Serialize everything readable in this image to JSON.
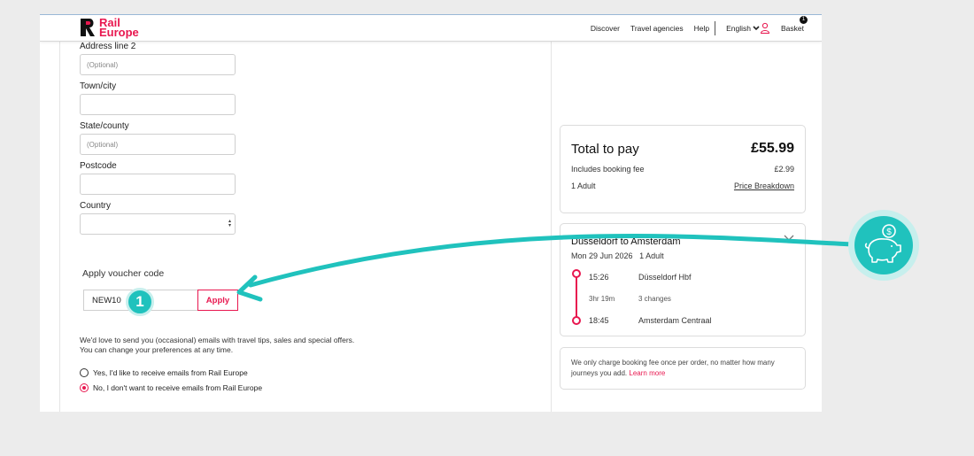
{
  "header": {
    "logo_line1": "Rail",
    "logo_line2": "Europe",
    "nav": {
      "discover": "Discover",
      "travel_agencies": "Travel agencies",
      "help": "Help",
      "language": "English",
      "basket": "Basket",
      "basket_count": "1"
    }
  },
  "form": {
    "address2_label": "Address line 2",
    "address2_placeholder": "(Optional)",
    "town_label": "Town/city",
    "state_label": "State/county",
    "state_placeholder": "(Optional)",
    "postcode_label": "Postcode",
    "country_label": "Country"
  },
  "voucher": {
    "label": "Apply voucher code",
    "value": "NEW10",
    "apply_label": "Apply",
    "step_number": "1"
  },
  "emails": {
    "line1": "We'd love to send you (occasional) emails with travel tips, sales and special offers.",
    "line2": "You can change your preferences at any time.",
    "option_yes": "Yes, I'd like to receive emails from Rail Europe",
    "option_no": "No, I don't want to receive emails from Rail Europe",
    "selected": "no"
  },
  "summary": {
    "total_label": "Total to pay",
    "total_price": "£55.99",
    "fee_label": "Includes booking fee",
    "fee_value": "£2.99",
    "passengers": "1 Adult",
    "breakdown_link": "Price Breakdown"
  },
  "journey": {
    "title": "Düsseldorf to Amsterdam",
    "date": "Mon 29 Jun 2026",
    "passengers": "1 Adult",
    "depart_time": "15:26",
    "depart_station": "Düsseldorf Hbf",
    "duration": "3hr 19m",
    "changes": "3 changes",
    "arrive_time": "18:45",
    "arrive_station": "Amsterdam Centraal"
  },
  "info": {
    "text": "We only charge booking fee once per order, no matter how many journeys you add.",
    "link": "Learn more"
  },
  "colors": {
    "brand": "#e8174f",
    "accent": "#20c2bd"
  },
  "icons": {
    "user": "user-icon",
    "chevron": "chevron-down-icon",
    "piggy": "piggy-bank-icon"
  }
}
